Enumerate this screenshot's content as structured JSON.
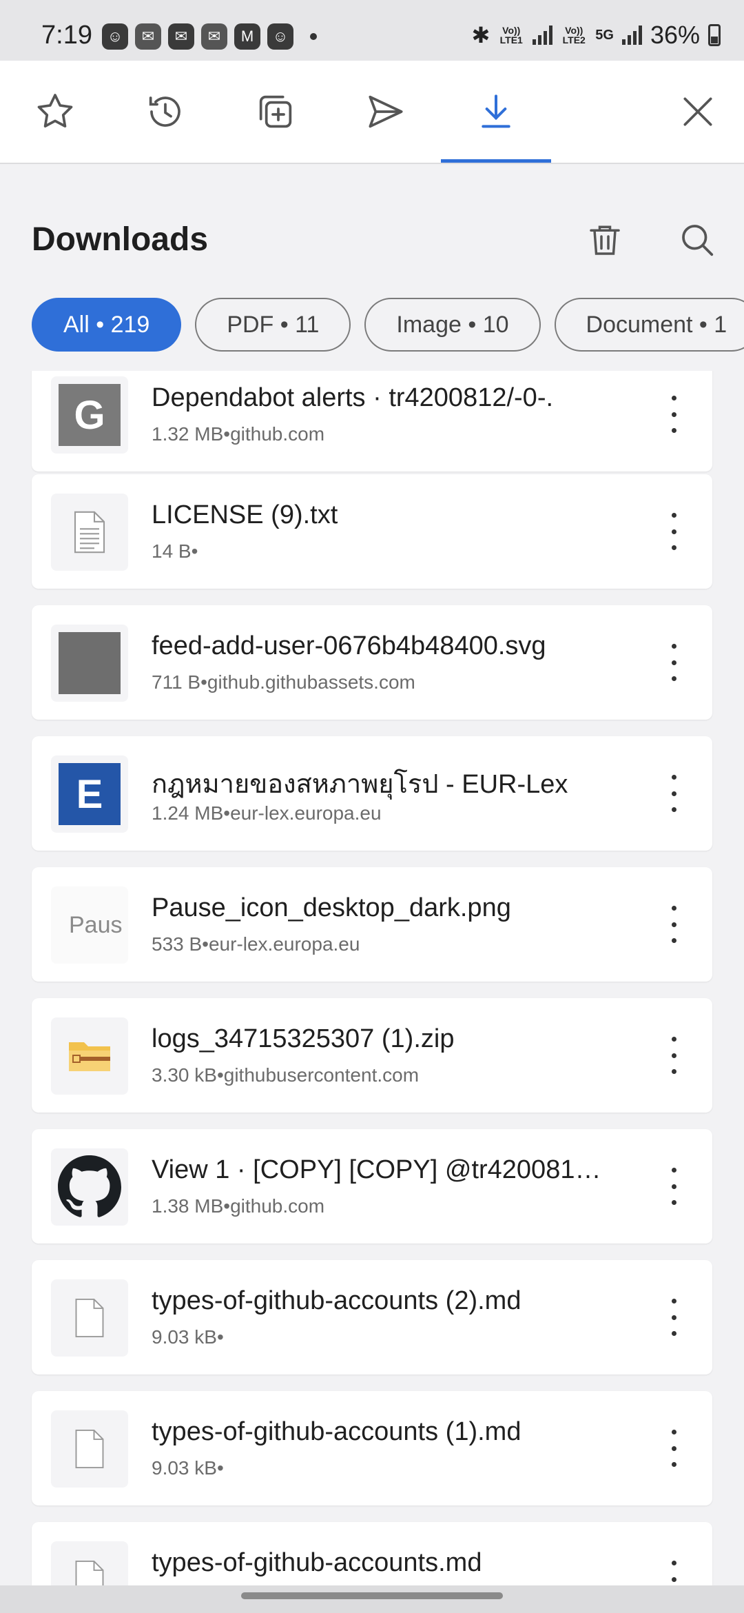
{
  "status_bar": {
    "time": "7:19",
    "battery": "36%",
    "lte1": "Vo)) LTE1",
    "lte2": "Vo)) LTE2",
    "network": "5G",
    "notification_icons": [
      "app-icon",
      "mail-icon",
      "email-icon",
      "mail-icon",
      "gmail-icon",
      "app-icon"
    ]
  },
  "toolbar": {
    "items": [
      {
        "name": "bookmarks",
        "icon": "star-icon"
      },
      {
        "name": "history",
        "icon": "history-icon"
      },
      {
        "name": "tabs",
        "icon": "add-tab-icon"
      },
      {
        "name": "send",
        "icon": "send-icon"
      },
      {
        "name": "downloads",
        "icon": "download-icon",
        "active": true
      },
      {
        "name": "close",
        "icon": "close-icon"
      }
    ],
    "accent_color": "#2f6fd8"
  },
  "header": {
    "title": "Downloads"
  },
  "filters": [
    {
      "label": "All • 219",
      "selected": true
    },
    {
      "label": "PDF • 11",
      "selected": false
    },
    {
      "label": "Image • 10",
      "selected": false
    },
    {
      "label": "Document • 1",
      "selected": false
    }
  ],
  "downloads": [
    {
      "name": "Dependabot alerts · tr4200812/-0-.",
      "size": "1.32 MB",
      "source": "github.com",
      "meta": "1.32 MB•github.com",
      "thumb": "G"
    },
    {
      "name": "LICENSE (9).txt",
      "size": "14 B",
      "source": "",
      "meta": "14 B•",
      "thumb": "text-file-icon"
    },
    {
      "name": "feed-add-user-0676b4b48400.svg",
      "size": "711 B",
      "source": "github.githubassets.com",
      "meta": "711 B•github.githubassets.com",
      "thumb": "gray-square"
    },
    {
      "name": "กฎหมายของสหภาพยุโรป - EUR-Lex",
      "size": "1.24 MB",
      "source": "eur-lex.europa.eu",
      "meta": "1.24 MB•eur-lex.europa.eu",
      "thumb": "E"
    },
    {
      "name": "Pause_icon_desktop_dark.png",
      "size": "533 B",
      "source": "eur-lex.europa.eu",
      "meta": "533 B•eur-lex.europa.eu",
      "thumb": "Paus"
    },
    {
      "name": "logs_34715325307 (1).zip",
      "size": "3.30 kB",
      "source": "githubusercontent.com",
      "meta": "3.30 kB•githubusercontent.com",
      "thumb": "folder-zip-icon"
    },
    {
      "name": "View 1 · [COPY] [COPY] @tr420081…",
      "size": "1.38 MB",
      "source": "github.com",
      "meta": "1.38 MB•github.com",
      "thumb": "github-icon"
    },
    {
      "name": "types-of-github-accounts (2).md",
      "size": "9.03 kB",
      "source": "",
      "meta": "9.03 kB•",
      "thumb": "file-icon"
    },
    {
      "name": "types-of-github-accounts (1).md",
      "size": "9.03 kB",
      "source": "",
      "meta": "9.03 kB•",
      "thumb": "file-icon"
    },
    {
      "name": "types-of-github-accounts.md",
      "size": "",
      "source": "",
      "meta": "",
      "thumb": "file-icon"
    }
  ]
}
